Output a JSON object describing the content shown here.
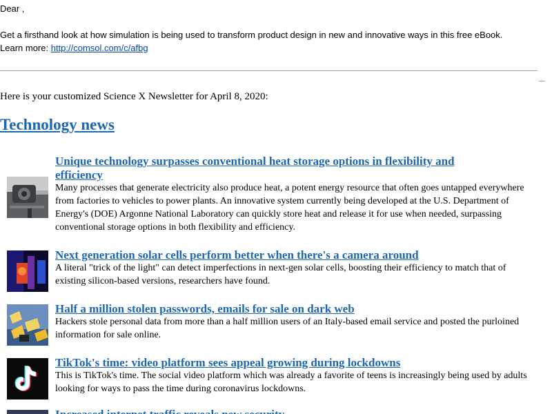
{
  "email": {
    "greeting": "Dear ,",
    "promo_text": "Get a firsthand look at how simulation is being used to transform product design in new and innovative ways in this free eBook.",
    "learn_more_label": "Learn more:",
    "promo_link": "http://comsol.com/c/afbg",
    "intro": "Here is your customized Science X Newsletter for April 8, 2020:"
  },
  "section": {
    "title": "Technology news"
  },
  "articles": [
    {
      "title": "Unique technology surpasses conventional heat storage options in flexibility and efficiency",
      "summary": "Many processes that generate electricity also produce heat, a potent energy resource that often goes untapped everywhere from factories to vehicles to power plants. An innovative system currently being developed at the U.S. Department of Energy's (DOE) Argonne National Laboratory can quickly store heat and release it for use when needed, surpassing conventional storage options in both flexibility and efficiency.",
      "thumbnail_icon": "industrial-heat-storage-photo"
    },
    {
      "title": "Next generation solar cells perform better when there's a camera around",
      "summary": "A literal \"trick of the light\" can detect imperfections in next-gen solar cells, boosting their efficiency to match that of existing silicon-based versions, researchers have found.",
      "thumbnail_icon": "solar-cell-lab-photo"
    },
    {
      "title": "Half a million stolen passwords, emails for sale on dark web",
      "summary": "Hackers stole personal data from more than a half million users of an Italy-based email service and posted the purloined information for sale online.",
      "thumbnail_icon": "email-envelopes-photo"
    },
    {
      "title": "TikTok's time: video platform sees appeal growing during lockdowns",
      "summary": "This is TikTok's time. The social video platform which was already a favorite of teens is increasingly being used by adults looking for ways to pass the time during coronavirus lockdowns.",
      "thumbnail_icon": "tiktok-logo-photo",
      "thumbnail_text": "TikTok"
    }
  ],
  "partial_article": {
    "title": "Increased internet traffic reveals new security"
  },
  "colors": {
    "link": "#1c67b2",
    "promo_link": "#0645ad",
    "text": "#000000",
    "rule": "#a0a0a0"
  }
}
